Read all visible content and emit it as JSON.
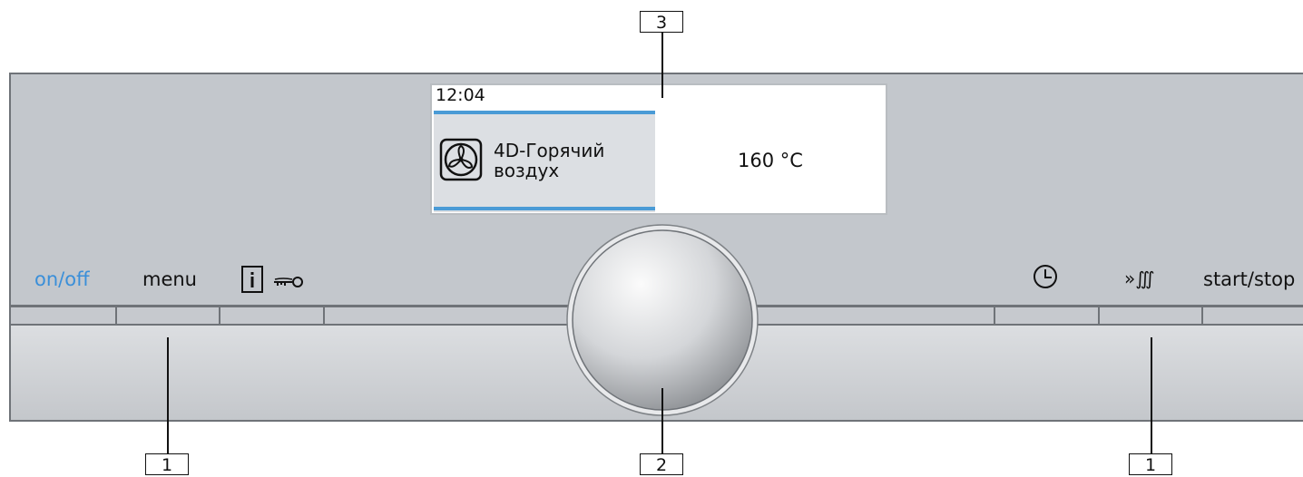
{
  "display": {
    "time": "12:04",
    "mode_line1": "4D-Горячий",
    "mode_line2": "воздух",
    "temperature": "160 °C",
    "mode_icon": "fan-icon",
    "accent_color": "#4a9bd6"
  },
  "buttons": {
    "on_off": "on/off",
    "menu": "menu",
    "info_icon": "info-icon",
    "key_icon": "key-icon",
    "clock_icon": "clock-icon",
    "rapid_heat_label": "»∭",
    "start_stop": "start/stop"
  },
  "callouts": {
    "display": "3",
    "selector": "2",
    "buttons_left": "1",
    "buttons_right": "1"
  },
  "colors": {
    "on_off": "#3a8fd9"
  }
}
